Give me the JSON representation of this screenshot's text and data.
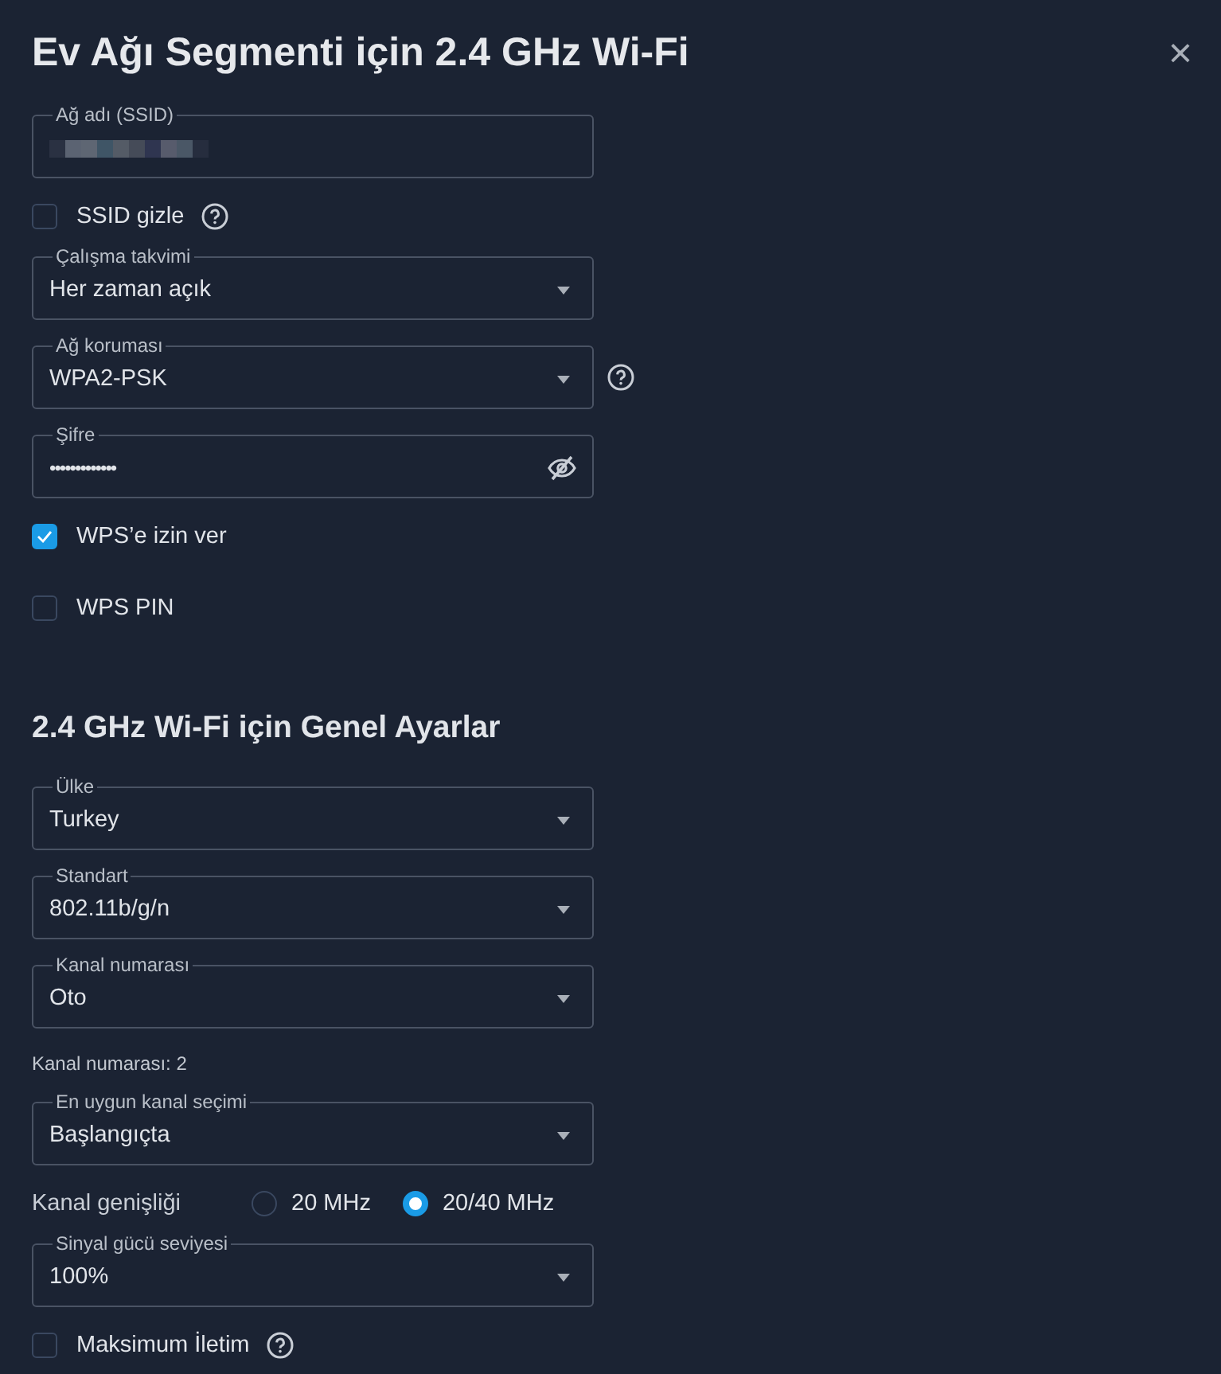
{
  "title": "Ev Ağı Segmenti için 2.4 GHz Wi-Fi",
  "close": "×",
  "items": [
    {
      "kind": "text",
      "label": "Ağ adı (SSID)",
      "redacted": true
    },
    {
      "kind": "checkbox",
      "label": "SSID gizle",
      "checked": false,
      "help": true
    },
    {
      "kind": "select",
      "label": "Çalışma takvimi",
      "value": "Her zaman açık"
    },
    {
      "kind": "select",
      "label": "Ağ koruması",
      "value": "WPA2-PSK",
      "help": true
    },
    {
      "kind": "password",
      "label": "Şifre",
      "value": "•••••••••••••"
    },
    {
      "kind": "checkbox",
      "label": "WPS’e izin ver",
      "checked": true
    },
    {
      "kind": "checkbox",
      "label": "WPS PIN",
      "checked": false
    },
    {
      "kind": "heading",
      "text": "2.4 GHz Wi-Fi için Genel Ayarlar"
    },
    {
      "kind": "select",
      "label": "Ülke",
      "value": "Turkey"
    },
    {
      "kind": "select",
      "label": "Standart",
      "value": "802.11b/g/n"
    },
    {
      "kind": "select",
      "label": "Kanal numarası",
      "value": "Oto"
    },
    {
      "kind": "note",
      "text": "Kanal numarası: 2"
    },
    {
      "kind": "select",
      "label": "En uygun kanal seçimi",
      "value": "Başlangıçta"
    },
    {
      "kind": "radios",
      "label": "Kanal genişliği",
      "options": [
        {
          "label": "20 MHz",
          "selected": false
        },
        {
          "label": "20/40 MHz",
          "selected": true
        }
      ]
    },
    {
      "kind": "select",
      "label": "Sinyal gücü seviyesi",
      "value": "100%"
    },
    {
      "kind": "checkbox",
      "label": "Maksimum İletim",
      "checked": false,
      "help": true
    }
  ]
}
